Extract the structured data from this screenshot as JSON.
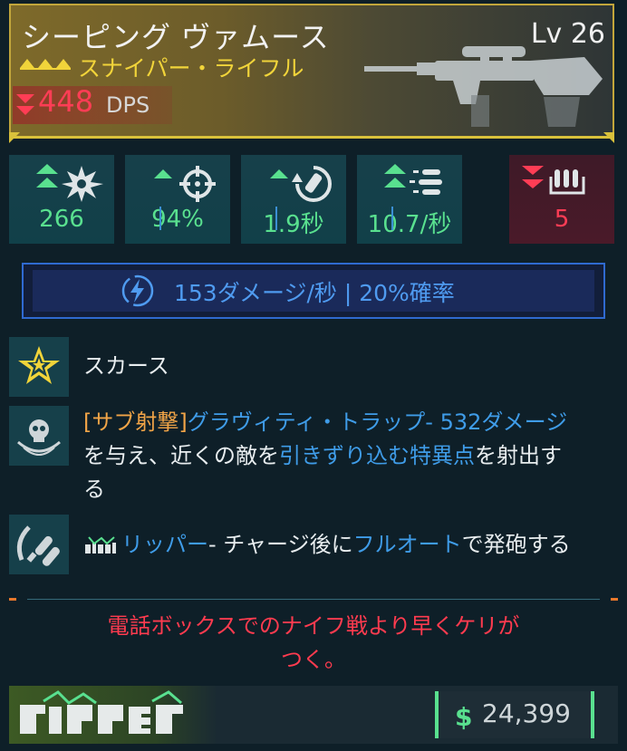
{
  "weapon": {
    "name": "シーピング ヴァムース",
    "level": "Lv 26",
    "type": "スナイパー・ライフル",
    "dps_value": "448",
    "dps_label": "DPS",
    "dps_trend": "down"
  },
  "stats": [
    {
      "icon": "damage-burst-icon",
      "trend": "up-double",
      "value": "266"
    },
    {
      "icon": "crosshair-accuracy-icon",
      "trend": "up",
      "value": "94%"
    },
    {
      "icon": "reload-time-icon",
      "trend": "up",
      "value": "1.9秒"
    },
    {
      "icon": "fire-rate-icon",
      "trend": "up-double",
      "value": "10.7/秒"
    },
    {
      "icon": "magazine-ammo-icon",
      "trend": "down-double",
      "value": "5"
    }
  ],
  "elemental": {
    "icon": "shock-lightning-icon",
    "text": "153ダメージ/秒 | 20%確率"
  },
  "perks": {
    "scarce": {
      "icon": "star-scarce-icon",
      "text": "スカース"
    },
    "alt_fire": {
      "icon": "skull-gravity-icon",
      "tag": "[サブ射撃]",
      "name": "グラヴィティ・トラップ",
      "dash": "- ",
      "damage": "532ダメージ",
      "line2a": "を与え、近くの敵を",
      "line2b": "引きずり込む特異点",
      "line2c": "を射出す",
      "line3": "る"
    },
    "ripper": {
      "icon": "ripper-bullets-icon",
      "name": "リッパー",
      "text_a": "- チャージ後に",
      "highlight": "フルオート",
      "text_b": "で発砲する"
    }
  },
  "flavor": {
    "line1": "電話ボックスでのナイフ戦より早くケリが",
    "line2": "つく。"
  },
  "footer": {
    "brand": "RIPPER",
    "price_icon": "$",
    "price": "24,399"
  },
  "colors": {
    "legendary_gold": "#c2a63b",
    "up_green": "#59e08f",
    "down_red": "#ff3d55",
    "shock_blue": "#4f9bf0",
    "highlight_orange": "#f1a447"
  }
}
